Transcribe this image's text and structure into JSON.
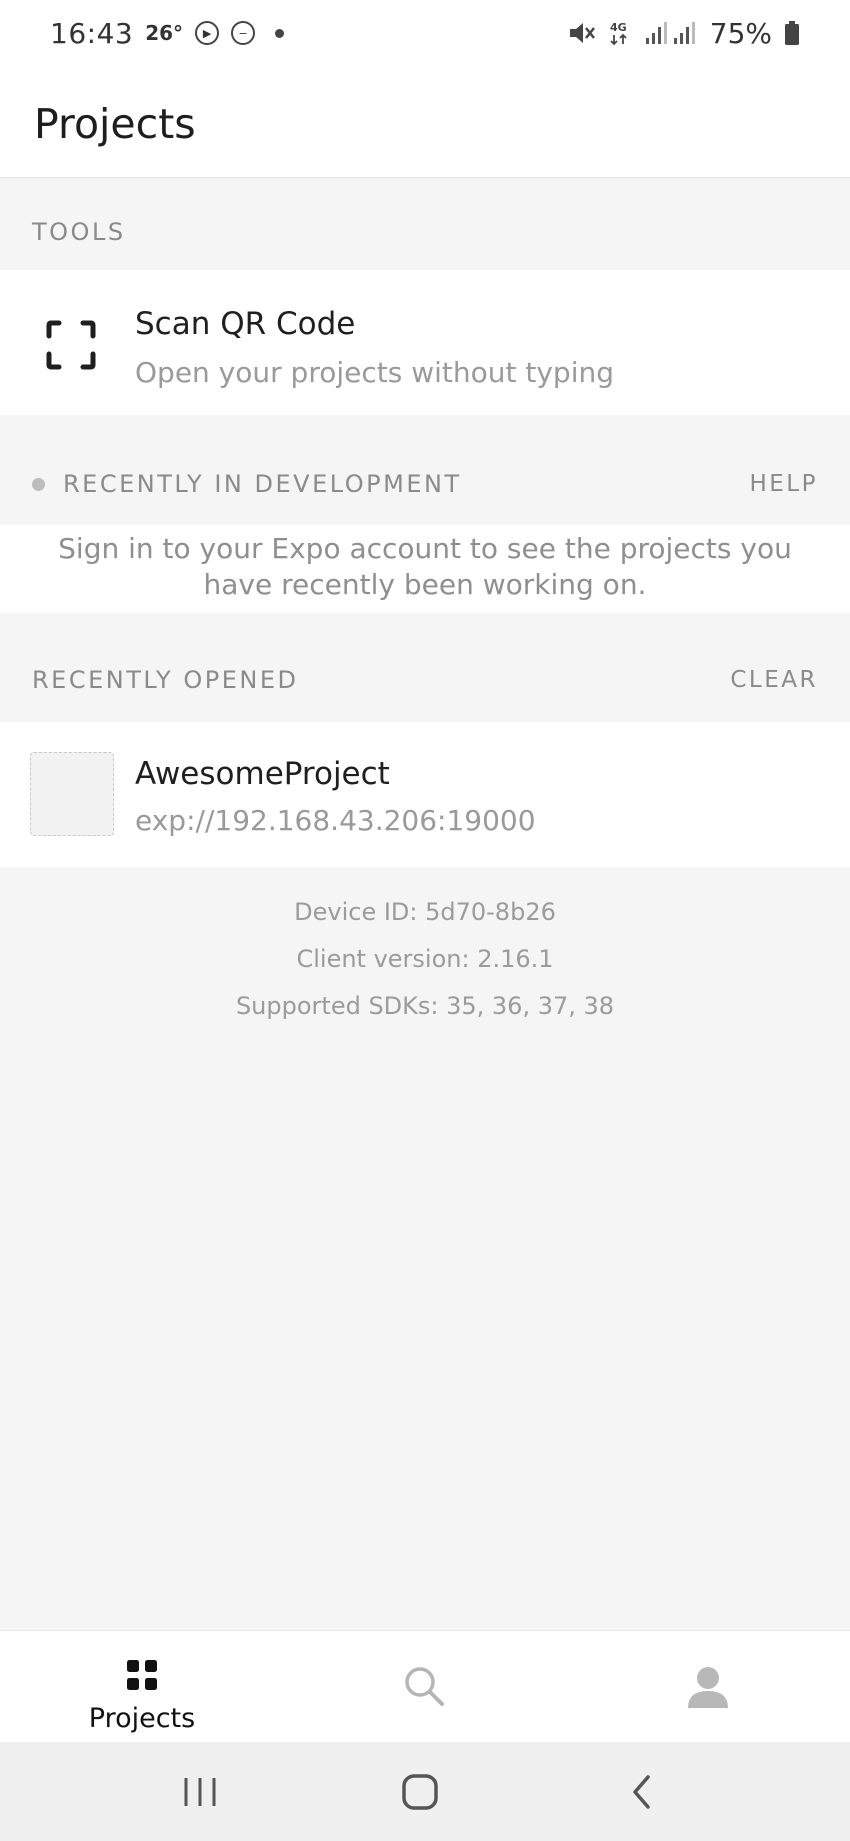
{
  "status_bar": {
    "time": "16:43",
    "temperature": "26°",
    "battery_percent": "75%",
    "network": "4G"
  },
  "header": {
    "title": "Projects"
  },
  "tools": {
    "heading": "TOOLS",
    "scan_qr": {
      "title": "Scan QR Code",
      "subtitle": "Open your projects without typing",
      "icon": "qr-scan-icon"
    }
  },
  "recently_in_development": {
    "heading": "RECENTLY IN DEVELOPMENT",
    "action": "HELP",
    "message": "Sign in to your Expo account to see the projects you have recently been working on."
  },
  "recently_opened": {
    "heading": "RECENTLY OPENED",
    "action": "CLEAR",
    "projects": [
      {
        "name": "AwesomeProject",
        "url": "exp://192.168.43.206:19000"
      }
    ]
  },
  "info": {
    "device_id": "Device ID: 5d70-8b26",
    "client_version": "Client version: 2.16.1",
    "supported_sdks": "Supported SDKs: 35, 36, 37, 38"
  },
  "tab_bar": {
    "tabs": [
      {
        "label": "Projects",
        "icon": "grid-icon",
        "active": true
      },
      {
        "label": "",
        "icon": "search-icon",
        "active": false
      },
      {
        "label": "",
        "icon": "user-icon",
        "active": false
      }
    ]
  },
  "colors": {
    "background": "#f5f5f5",
    "surface": "#ffffff",
    "muted_text": "#8a8a8a",
    "primary_text": "#1f1f1f"
  }
}
